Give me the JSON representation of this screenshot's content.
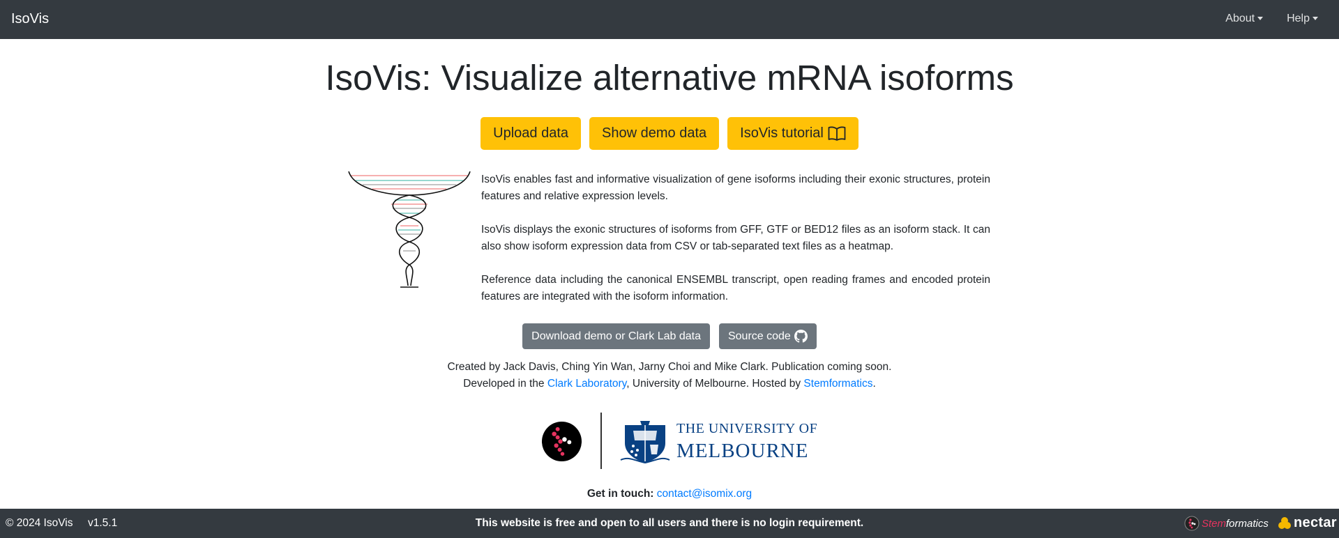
{
  "navbar": {
    "brand": "IsoVis",
    "menu": [
      {
        "label": "About"
      },
      {
        "label": "Help"
      }
    ]
  },
  "main": {
    "title": "IsoVis: Visualize alternative mRNA isoforms",
    "buttons": {
      "upload": "Upload data",
      "demo": "Show demo data",
      "tutorial": "IsoVis tutorial"
    },
    "intro": [
      "IsoVis enables fast and informative visualization of gene isoforms including their exonic structures, protein features and relative expression levels.",
      "IsoVis displays the exonic structures of isoforms from GFF, GTF or BED12 files as an isoform stack. It can also show isoform expression data from CSV or tab-separated text files as a heatmap.",
      "Reference data including the canonical ENSEMBL transcript, open reading frames and encoded protein features are integrated with the isoform information."
    ],
    "secondary_buttons": {
      "download": "Download demo or Clark Lab data",
      "source": "Source code"
    },
    "credits": {
      "line1": "Created by Jack Davis, Ching Yin Wan, Jarny Choi and Mike Clark. Publication coming soon.",
      "line2_prefix": "Developed in the ",
      "clark_link": "Clark Laboratory",
      "line2_middle": ", University of Melbourne. Hosted by ",
      "stem_link": "Stemformatics",
      "line2_suffix": "."
    },
    "logos": {
      "unimelb_line1": "THE UNIVERSITY OF",
      "unimelb_line2": "MELBOURNE"
    },
    "contact": {
      "label": "Get in touch:",
      "email": "contact@isomix.org"
    }
  },
  "footer": {
    "copyright": "© 2024 IsoVis",
    "version": "v1.5.1",
    "message": "This website is free and open to all users and there is no login requirement.",
    "stem_prefix": "Stem",
    "stem_suffix": "formatics",
    "nectar": "nectar"
  },
  "colors": {
    "navbar": "#343a40",
    "warning": "#ffc107",
    "secondary": "#6c757d",
    "link": "#007bff",
    "unimelb_blue": "#094183",
    "stem_red": "#e5335f"
  }
}
